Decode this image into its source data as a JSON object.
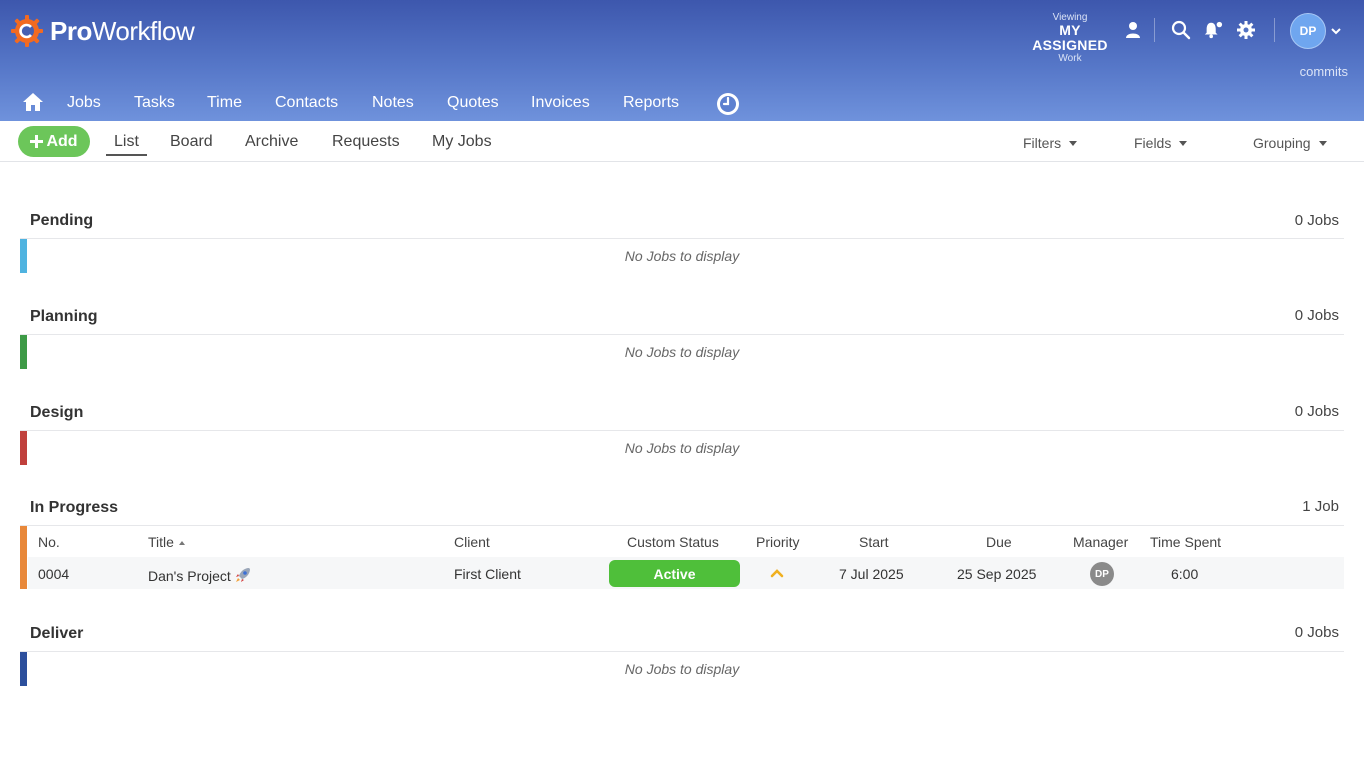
{
  "app": {
    "logo_bold": "Pro",
    "logo_rest": "Workflow"
  },
  "header": {
    "viewing_top": "Viewing",
    "viewing_main": "MY ASSIGNED",
    "viewing_bottom": "Work",
    "avatar_initials": "DP",
    "commits_label": "commits"
  },
  "mainnav": {
    "items": [
      {
        "label": "Jobs",
        "active": true
      },
      {
        "label": "Tasks"
      },
      {
        "label": "Time"
      },
      {
        "label": "Contacts"
      },
      {
        "label": "Notes"
      },
      {
        "label": "Quotes"
      },
      {
        "label": "Invoices"
      },
      {
        "label": "Reports"
      }
    ]
  },
  "subbar": {
    "add_label": "Add",
    "tabs": [
      {
        "label": "List",
        "active": true
      },
      {
        "label": "Board"
      },
      {
        "label": "Archive"
      },
      {
        "label": "Requests"
      },
      {
        "label": "My Jobs"
      }
    ],
    "filters_label": "Filters",
    "fields_label": "Fields",
    "grouping_label": "Grouping"
  },
  "groups": [
    {
      "name": "Pending",
      "count": "0 Jobs",
      "color": "#4fb3e0",
      "empty": "No Jobs to display"
    },
    {
      "name": "Planning",
      "count": "0 Jobs",
      "color": "#3d9a46",
      "empty": "No Jobs to display"
    },
    {
      "name": "Design",
      "count": "0 Jobs",
      "color": "#c0403c",
      "empty": "No Jobs to display"
    },
    {
      "name": "In Progress",
      "count": "1 Job",
      "color": "#e8883a"
    },
    {
      "name": "Deliver",
      "count": "0 Jobs",
      "color": "#2c4f9c",
      "empty": "No Jobs to display"
    }
  ],
  "table": {
    "columns": [
      "No.",
      "Title",
      "Client",
      "Custom Status",
      "Priority",
      "Start",
      "Due",
      "Manager",
      "Time Spent"
    ],
    "rows": [
      {
        "no": "0004",
        "title": "Dan's Project",
        "client": "First Client",
        "status": "Active",
        "status_color": "#4fbf3a",
        "priority_icon": "chevron-up-icon",
        "start": "7 Jul 2025",
        "due": "25 Sep 2025",
        "manager_initials": "DP",
        "time_spent": "6:00"
      }
    ]
  }
}
